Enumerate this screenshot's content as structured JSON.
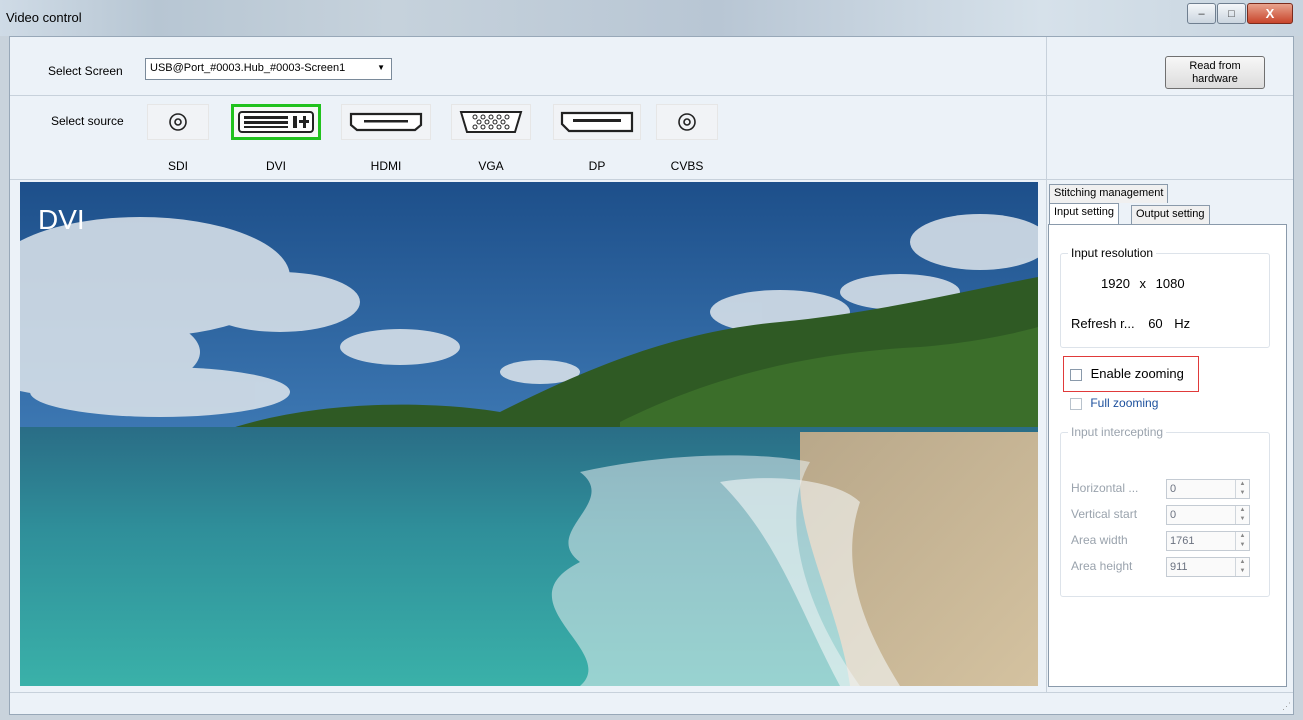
{
  "window": {
    "title": "Video control",
    "minimize_glyph": "–",
    "maximize_glyph": "□",
    "close_glyph": "X"
  },
  "screen_select": {
    "label": "Select Screen",
    "value": "USB@Port_#0003.Hub_#0003-Screen1"
  },
  "read_button": {
    "line1": "Read from",
    "line2": "hardware"
  },
  "source_select": {
    "label": "Select source",
    "selected": "DVI",
    "sources": [
      {
        "label": "SDI",
        "icon": "bnc-connector-icon"
      },
      {
        "label": "DVI",
        "icon": "dvi-connector-icon"
      },
      {
        "label": "HDMI",
        "icon": "hdmi-connector-icon"
      },
      {
        "label": "VGA",
        "icon": "vga-connector-icon"
      },
      {
        "label": "DP",
        "icon": "displayport-connector-icon"
      },
      {
        "label": "CVBS",
        "icon": "bnc-connector-icon"
      }
    ]
  },
  "preview": {
    "badge": "DVI"
  },
  "tabs": {
    "stitching": "Stitching management",
    "input": "Input setting",
    "output": "Output setting"
  },
  "input_resolution": {
    "title": "Input resolution",
    "width": "1920",
    "x": "x",
    "height": "1080",
    "refresh_label": "Refresh r...",
    "refresh_value": "60",
    "refresh_unit": "Hz"
  },
  "zoom": {
    "enable_label": "Enable zooming",
    "enable_checked": false,
    "full_label": "Full zooming",
    "full_checked": false,
    "highlight_color": "#e03a3a"
  },
  "intercepting": {
    "title": "Input intercepting",
    "fields": [
      {
        "label": "Horizontal ...",
        "value": "0"
      },
      {
        "label": "Vertical start",
        "value": "0"
      },
      {
        "label": "Area width",
        "value": "1761"
      },
      {
        "label": "Area height",
        "value": "911"
      }
    ]
  },
  "colors": {
    "selected_source_border": "#21c21e",
    "link_text": "#1b4f9c"
  }
}
